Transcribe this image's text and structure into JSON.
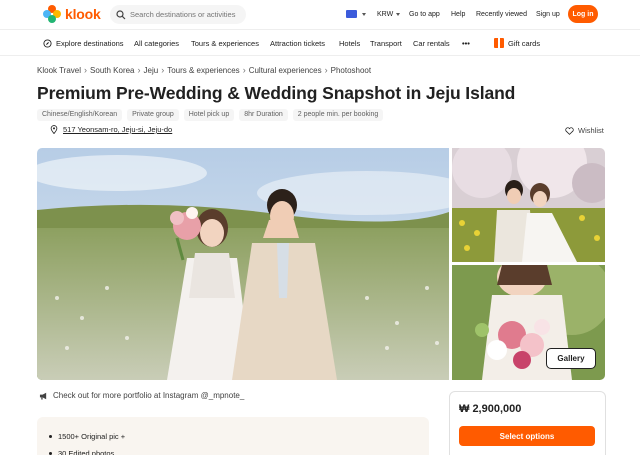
{
  "header": {
    "logo_text": "klook",
    "search_placeholder": "Search destinations or activities",
    "currency": "KRW",
    "links": [
      "Go to app",
      "Help",
      "Recently viewed",
      "Sign up"
    ],
    "login_label": "Log in"
  },
  "nav": {
    "items": [
      "Explore destinations",
      "All categories",
      "Tours & experiences",
      "Attraction tickets",
      "Hotels",
      "Transport",
      "Car rentals"
    ],
    "more": "•••",
    "gift_cards": "Gift cards"
  },
  "breadcrumb": [
    "Klook Travel",
    "South Korea",
    "Jeju",
    "Tours & experiences",
    "Cultural experiences",
    "Photoshoot"
  ],
  "title": "Premium Pre-Wedding & Wedding Snapshot in Jeju Island",
  "tags": [
    "Chinese/English/Korean",
    "Private group",
    "Hotel pick up",
    "8hr Duration",
    "2 people min. per booking"
  ],
  "address": "517 Yeonsam-ro, Jeju-si, Jeju-do",
  "wishlist_label": "Wishlist",
  "gallery_label": "Gallery",
  "instagram_note": "Check out for more portfolio at Instagram @_mpnote_",
  "highlights": [
    "1500+ Original pic +",
    "30 Edited photos"
  ],
  "price": "₩ 2,900,000",
  "select_label": "Select options",
  "colors": {
    "brand": "#ff5b00"
  }
}
